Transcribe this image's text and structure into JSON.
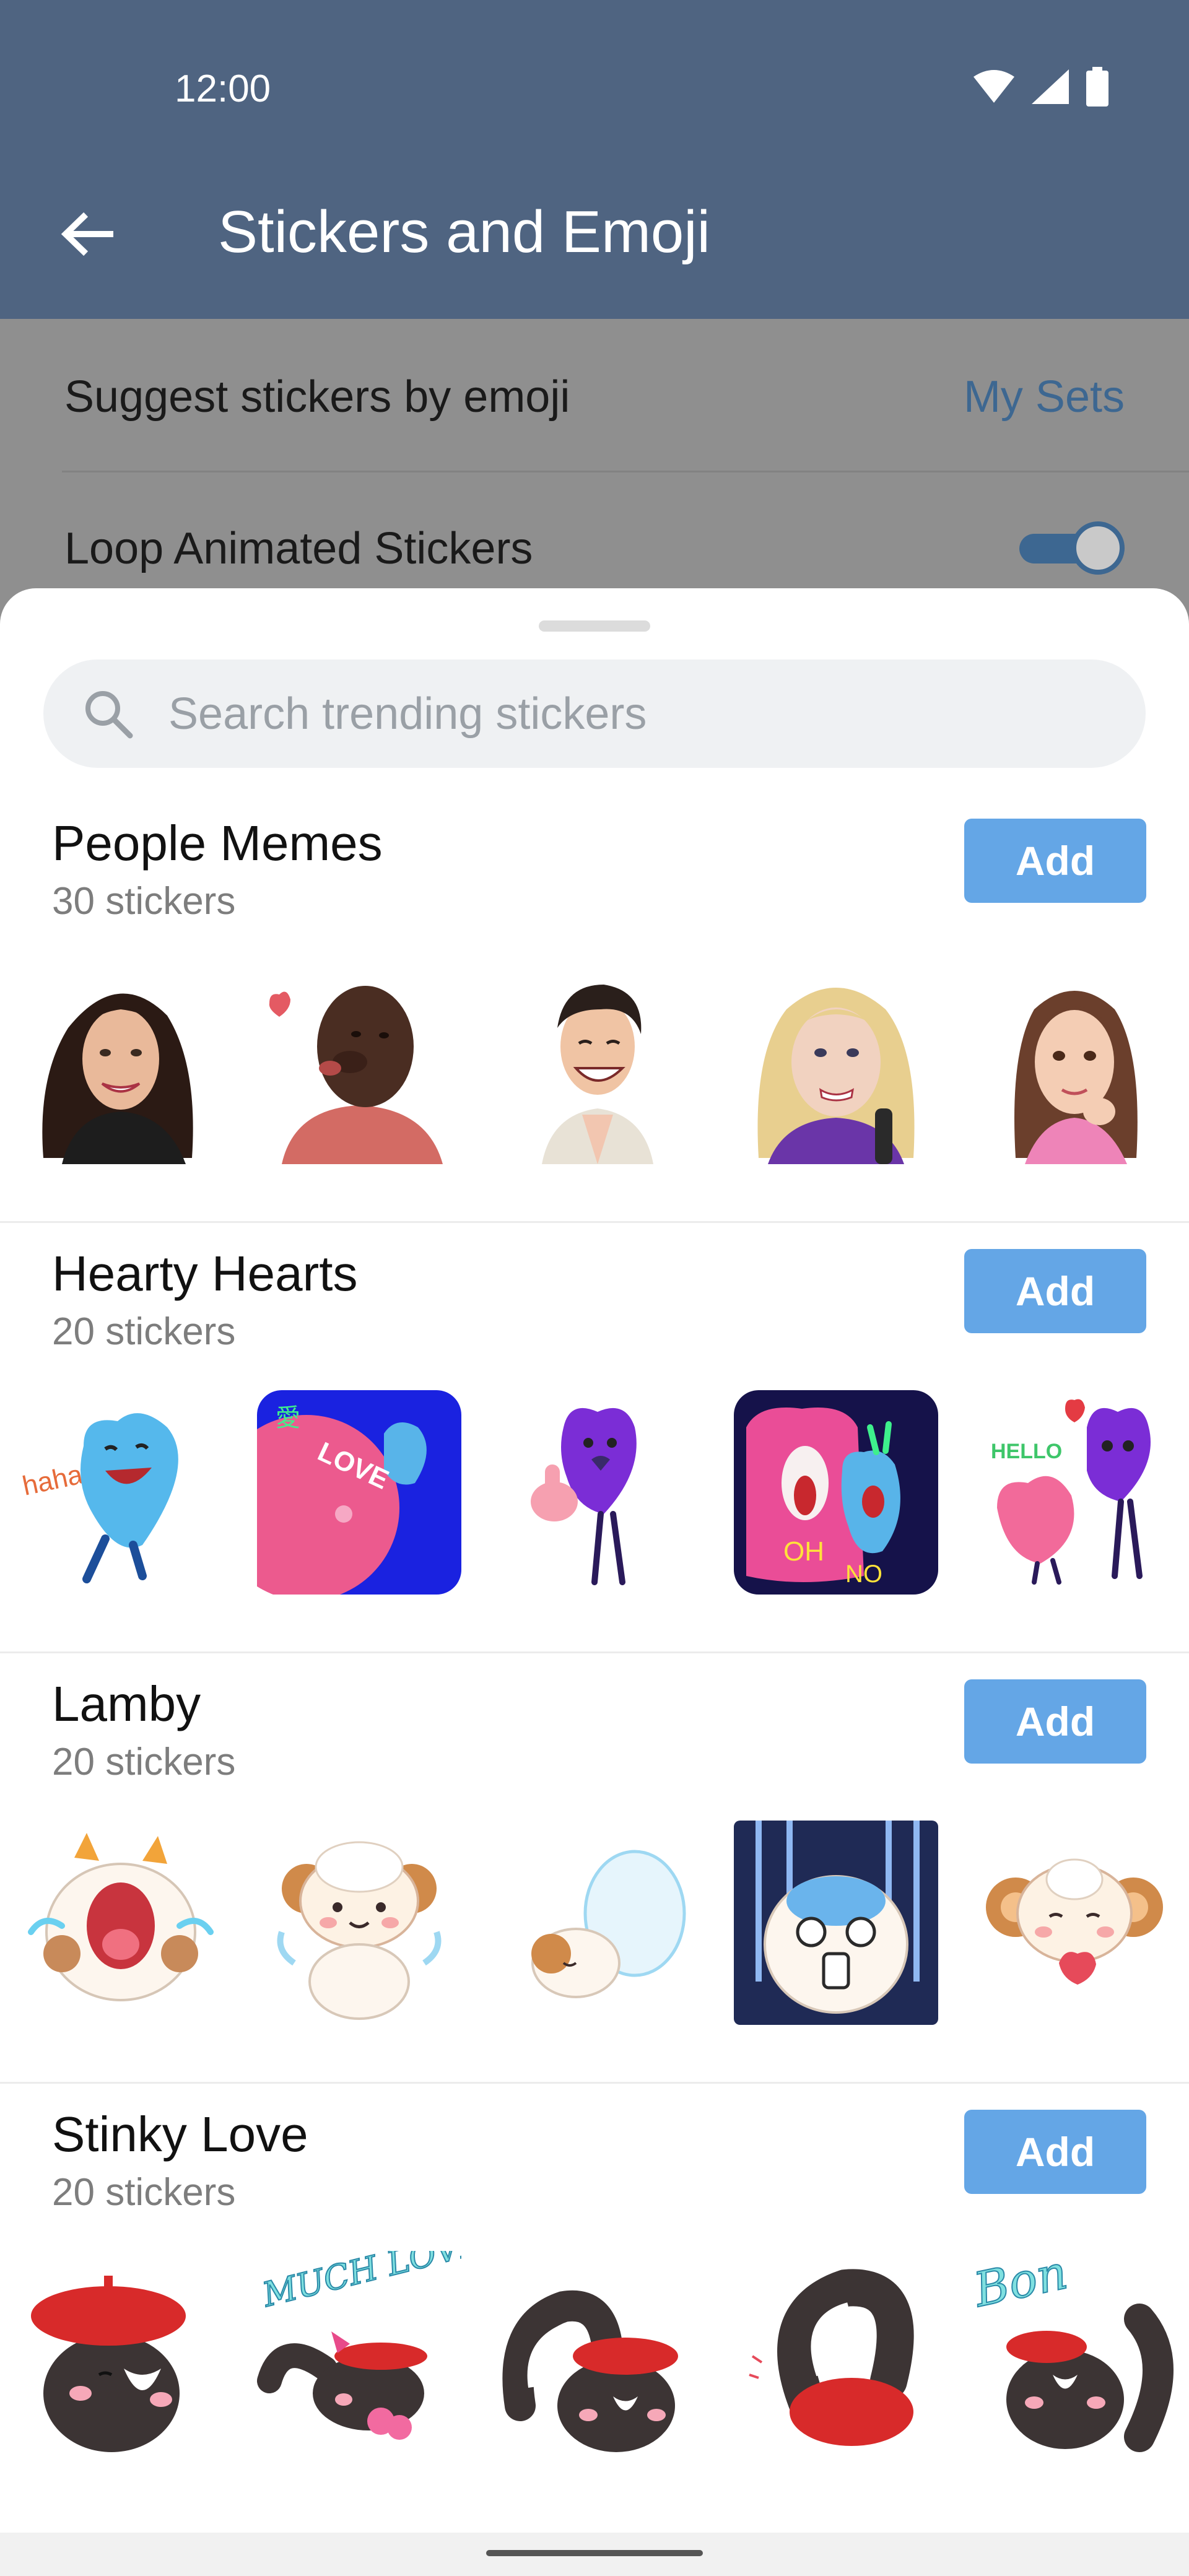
{
  "status_bar": {
    "time": "12:00",
    "icons": [
      "wifi-icon",
      "signal-icon",
      "battery-icon"
    ]
  },
  "app_bar": {
    "title": "Stickers and Emoji",
    "back_icon": "arrow-left-icon"
  },
  "settings": {
    "suggest_label": "Suggest stickers by emoji",
    "my_sets_label": "My Sets",
    "loop_label": "Loop Animated Stickers",
    "loop_enabled": true
  },
  "search": {
    "placeholder": "Search trending stickers",
    "value": ""
  },
  "packs": [
    {
      "title": "People Memes",
      "count": "30 stickers",
      "add_label": "Add",
      "stickers": [
        "woman-dark-hair-sticker",
        "man-heart-sticker",
        "man-laughing-sticker",
        "blonde-woman-sticker",
        "girl-thinking-sticker"
      ]
    },
    {
      "title": "Hearty Hearts",
      "count": "20 stickers",
      "add_label": "Add",
      "stickers": [
        "blue-heart-laughing-sticker",
        "love-kiss-sticker",
        "purple-heart-thumbs-up-sticker",
        "oh-no-sticker",
        "hello-hearts-sticker"
      ]
    },
    {
      "title": "Lamby",
      "count": "20 stickers",
      "add_label": "Add",
      "stickers": [
        "lamb-crying-sticker",
        "lamb-smiling-sticker",
        "lamb-sleeping-sticker",
        "lamb-shocked-sticker",
        "lamb-love-sticker"
      ]
    },
    {
      "title": "Stinky Love",
      "count": "20 stickers",
      "add_label": "Add",
      "stickers": [
        "skunk-beret-sticker",
        "skunk-much-love-sticker",
        "skunk-beret-2-sticker",
        "skunk-hiding-sticker",
        "skunk-bon-sticker"
      ],
      "sticker_texts": {
        "much_love": "MUCH LOVE",
        "bon": "Bon"
      }
    }
  ],
  "hearty_texts": {
    "love": "LOVE",
    "oh": "OH",
    "no": "NO",
    "hello": "HELLO",
    "haha": "haha",
    "love_char": "愛"
  },
  "colors": {
    "app_bar": "#4f6481",
    "accent": "#3d6791",
    "add_button": "#64a6e6",
    "sheet": "#ffffff"
  }
}
